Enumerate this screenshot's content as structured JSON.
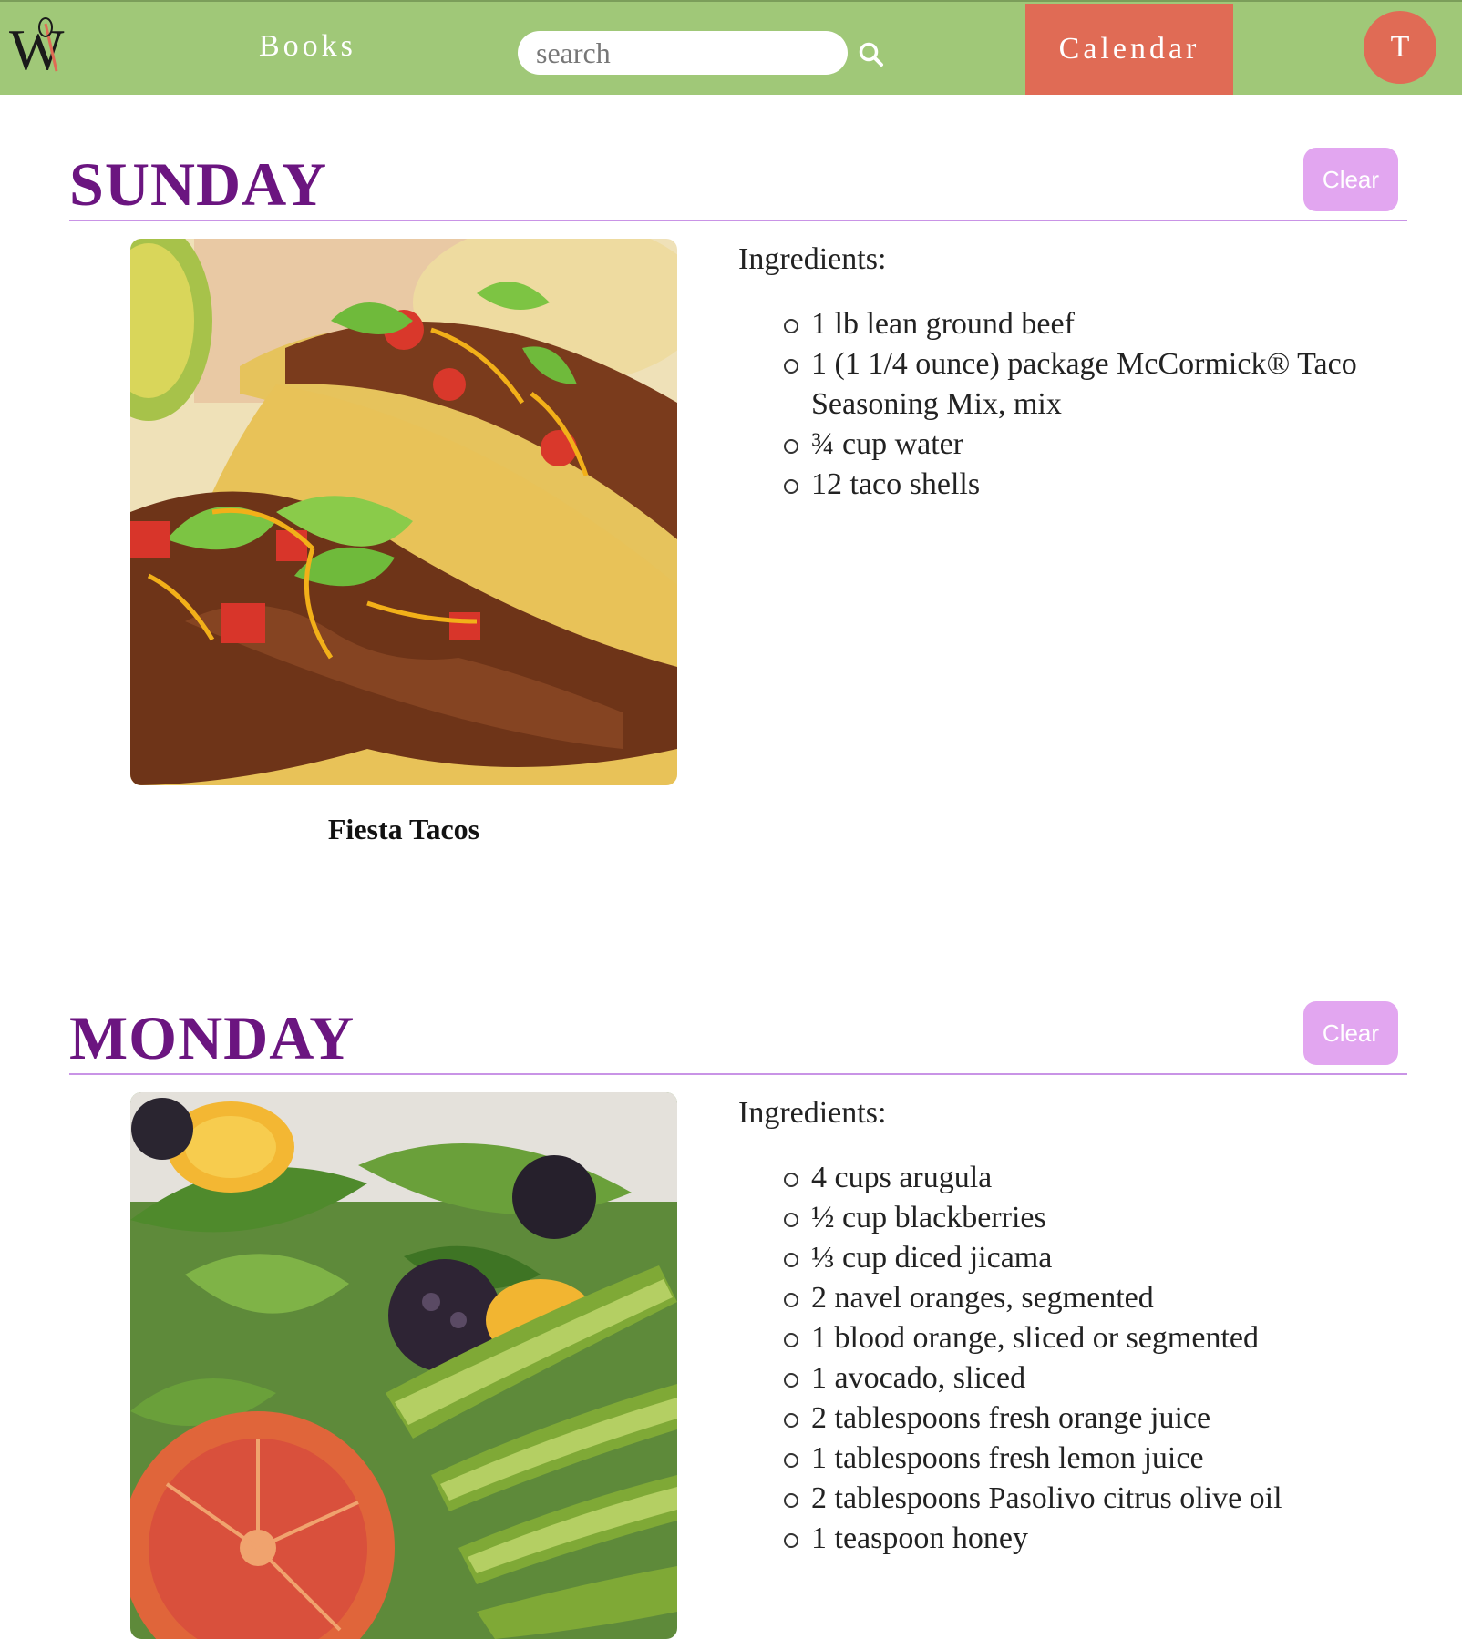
{
  "header": {
    "books_label": "Books",
    "search_placeholder": "search",
    "calendar_label": "Calendar",
    "avatar_initial": "T"
  },
  "days": [
    {
      "title": "SUNDAY",
      "clear_label": "Clear",
      "recipe_name": "Fiesta Tacos",
      "ingredients_label": "Ingredients:",
      "ingredients": [
        "1 lb lean ground beef",
        "1 (1 1/4 ounce) package McCormick® Taco Seasoning Mix, mix",
        "¾ cup water",
        "12 taco shells"
      ]
    },
    {
      "title": "MONDAY",
      "clear_label": "Clear",
      "ingredients_label": "Ingredients:",
      "ingredients": [
        "4 cups arugula",
        "½ cup blackberries",
        "⅓ cup diced jicama",
        "2 navel oranges, segmented",
        "1 blood orange, sliced or segmented",
        "1 avocado, sliced",
        "2 tablespoons fresh orange juice",
        "1 tablespoons fresh lemon juice",
        "2 tablespoons Pasolivo citrus olive oil",
        "1 teaspoon honey"
      ]
    }
  ],
  "colors": {
    "header_bg": "#a0c878",
    "accent": "#e06b55",
    "day_title": "#6b1580",
    "clear_button": "#e2a6f0",
    "rule": "#c994e6"
  }
}
